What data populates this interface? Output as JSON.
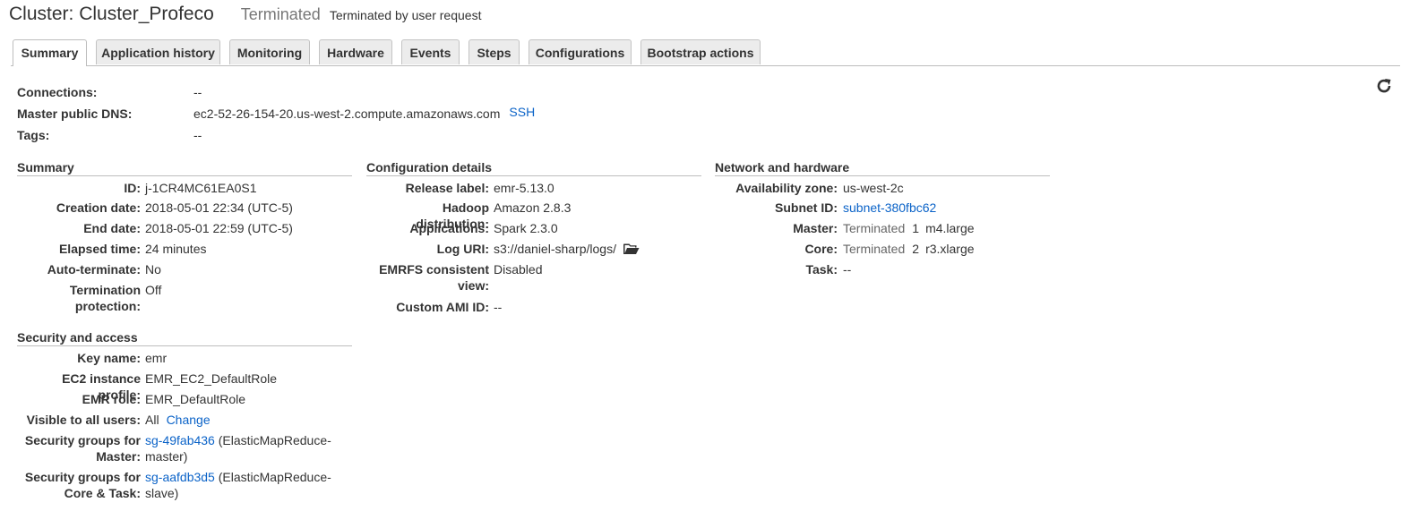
{
  "header": {
    "cluster_prefix": "Cluster: ",
    "cluster_name": "Cluster_Profeco",
    "status": "Terminated",
    "status_reason": "Terminated by user request"
  },
  "tabs": [
    {
      "label": "Summary",
      "active": true
    },
    {
      "label": "Application history"
    },
    {
      "label": "Monitoring"
    },
    {
      "label": "Hardware"
    },
    {
      "label": "Events"
    },
    {
      "label": "Steps"
    },
    {
      "label": "Configurations"
    },
    {
      "label": "Bootstrap actions"
    }
  ],
  "refresh": {
    "icon": "refresh-icon"
  },
  "connections": {
    "connections_label": "Connections:",
    "connections_value": "--",
    "dns_label": "Master public DNS:",
    "dns_value": "ec2-52-26-154-20.us-west-2.compute.amazonaws.com",
    "ssh_link": "SSH",
    "tags_label": "Tags:",
    "tags_value": "--"
  },
  "summary": {
    "title": "Summary",
    "id_label": "ID:",
    "id_value": "j-1CR4MC61EA0S1",
    "creation_label": "Creation date:",
    "creation_value": "2018-05-01 22:34 (UTC-5)",
    "end_label": "End date:",
    "end_value": "2018-05-01 22:59 (UTC-5)",
    "elapsed_label": "Elapsed time:",
    "elapsed_value": "24 minutes",
    "autoterm_label": "Auto-terminate:",
    "autoterm_value": "No",
    "termprot_label_1": "Termination",
    "termprot_label_2": "protection:",
    "termprot_value": "Off"
  },
  "security": {
    "title": "Security and access",
    "key_label": "Key name:",
    "key_value": "emr",
    "ec2_label": "EC2 instance profile:",
    "ec2_value": "EMR_EC2_DefaultRole",
    "emr_label": "EMR role:",
    "emr_value": "EMR_DefaultRole",
    "visible_label": "Visible to all users:",
    "visible_value": "All",
    "change_link": "Change",
    "sg_master_label_1": "Security groups for",
    "sg_master_label_2": "Master:",
    "sg_master_link": "sg-49fab436",
    "sg_master_rest_1": " (ElasticMapReduce-",
    "sg_master_rest_2": "master)",
    "sg_core_label_1": "Security groups for",
    "sg_core_label_2": "Core & Task:",
    "sg_core_link": "sg-aafdb3d5",
    "sg_core_rest_1": " (ElasticMapReduce-",
    "sg_core_rest_2": "slave)"
  },
  "config": {
    "title": "Configuration details",
    "release_label": "Release label:",
    "release_value": "emr-5.13.0",
    "hadoop_label": "Hadoop distribution:",
    "hadoop_value": "Amazon 2.8.3",
    "apps_label": "Applications:",
    "apps_value": "Spark 2.3.0",
    "log_label": "Log URI:",
    "log_value": "s3://daniel-sharp/logs/",
    "log_icon": "folder-open-icon",
    "emrfs_label_1": "EMRFS consistent",
    "emrfs_label_2": "view:",
    "emrfs_value": "Disabled",
    "ami_label": "Custom AMI ID:",
    "ami_value": "--"
  },
  "network": {
    "title": "Network and hardware",
    "az_label": "Availability zone:",
    "az_value": "us-west-2c",
    "subnet_label": "Subnet ID:",
    "subnet_value": "subnet-380fbc62",
    "master_label": "Master:",
    "master_status": "Terminated",
    "master_count": "1",
    "master_type": "m4.large",
    "core_label": "Core:",
    "core_status": "Terminated",
    "core_count": "2",
    "core_type": "r3.xlarge",
    "task_label": "Task:",
    "task_value": "--"
  },
  "colors": {
    "link": "#0b63c8",
    "muted": "#666666",
    "border": "#bdbdbd",
    "tab_bg": "#ececec"
  }
}
